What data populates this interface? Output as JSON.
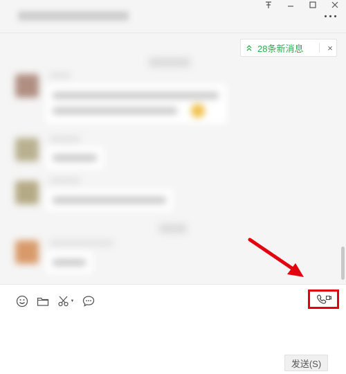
{
  "window": {
    "pin_icon": "pin-icon",
    "minimize_icon": "minimize-icon",
    "maximize_icon": "maximize-icon",
    "close_icon": "close-icon"
  },
  "header": {
    "title": "",
    "more_icon": "more-dots-icon"
  },
  "notice": {
    "new_messages": "28条新消息",
    "up_icon": "double-chevron-up-icon",
    "close_label": "×"
  },
  "toolbar": {
    "items": [
      "emoji-icon",
      "folder-icon",
      "scissors-icon",
      "chat-bubble-icon"
    ],
    "video_call_icon": "video-call-icon"
  },
  "input": {
    "send_label": "发送(S)"
  },
  "colors": {
    "accent_green": "#2dab4b",
    "highlight_red": "#e3000f"
  }
}
